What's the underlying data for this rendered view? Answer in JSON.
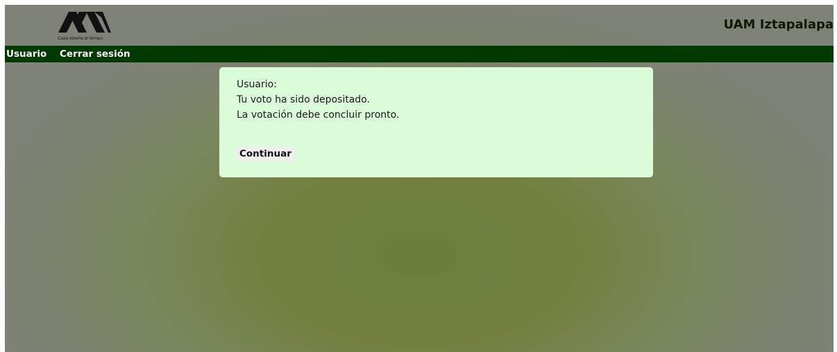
{
  "header": {
    "logo_tagline": "Casa abierta al tiempo",
    "site_title": "UAM Iztapalapa"
  },
  "navbar": {
    "items": [
      {
        "label": "Usuario"
      },
      {
        "label": "Cerrar sesión"
      }
    ]
  },
  "message": {
    "line1": "Usuario:",
    "line2": "Tu voto ha sido depositado.",
    "line3": "La votación debe concluir pronto.",
    "continue_label": "Continuar"
  },
  "colors": {
    "navbar": "#003900",
    "card_background": "#dbfcd9",
    "page_background": "#72803f"
  },
  "icons": {
    "logo": "uam-logo-icon"
  }
}
